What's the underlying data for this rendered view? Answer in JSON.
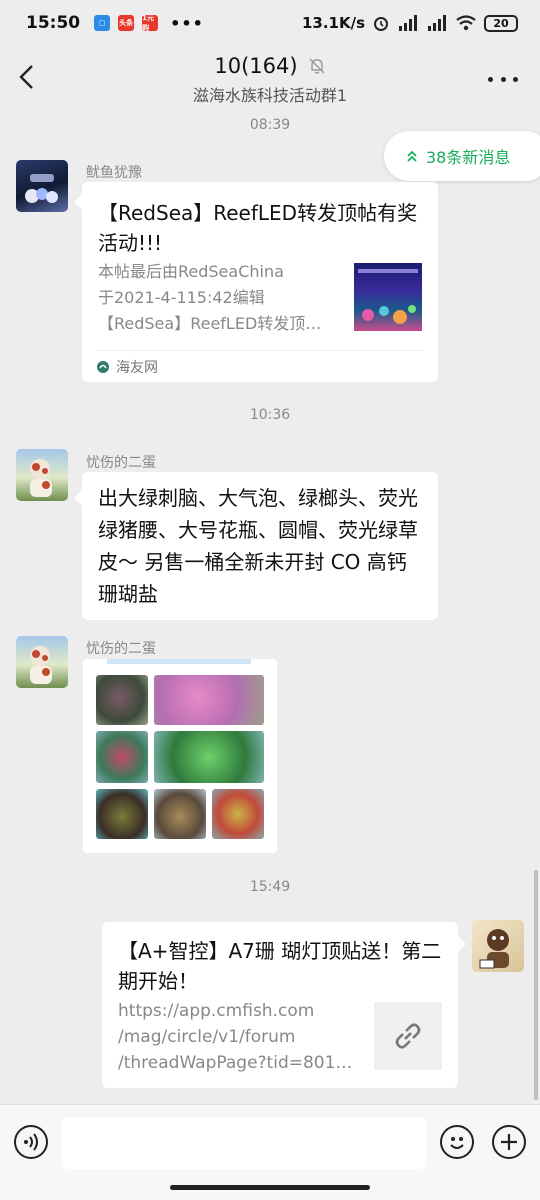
{
  "status_bar": {
    "time": "15:50",
    "app_icon_2": "头条",
    "app_icon_3": "1元购",
    "more": "•••",
    "net_speed": "13.1K/s",
    "battery": "20"
  },
  "header": {
    "title": "10(164)",
    "subtitle": "滋海水族科技活动群1"
  },
  "new_messages": {
    "label": "38条新消息"
  },
  "messages": [
    {
      "time": "08:39",
      "sender": "鱿鱼犹豫",
      "type": "link-card",
      "title": "【RedSea】ReefLED转发顶帖有奖活动!!!",
      "desc_line1": "本帖最后由RedSeaChina",
      "desc_line2": "于2021-4-115:42编辑",
      "desc_line3": "【RedSea】ReefLED转发顶…",
      "source": "海友网"
    },
    {
      "time": "10:36",
      "sender": "忧伤的二蛋",
      "type": "text",
      "text": "出大绿刺脑、大气泡、绿榔头、荧光绿猪腰、大号花瓶、圆帽、荧光绿草皮～ 另售一桶全新未开封 CO 高钙珊瑚盐"
    },
    {
      "sender": "忧伤的二蛋",
      "type": "image"
    },
    {
      "time": "15:49",
      "type": "link-card-self",
      "title": "【A+智控】A7珊 瑚灯顶贴送！第二期开始！",
      "desc_line1": "https://app.cmfish.com",
      "desc_line2": "/mag/circle/v1/forum",
      "desc_line3": "/threadWapPage?tid=801…"
    }
  ],
  "colors": {
    "background": "#ededed",
    "accent_green": "#1aad5b",
    "bubble": "#ffffff"
  },
  "icons": {
    "back": "back-arrow-icon",
    "mute": "bell-off-icon",
    "more": "more-dots-icon",
    "voice": "voice-icon",
    "emoji": "emoji-icon",
    "plus": "plus-icon",
    "link": "link-icon"
  }
}
